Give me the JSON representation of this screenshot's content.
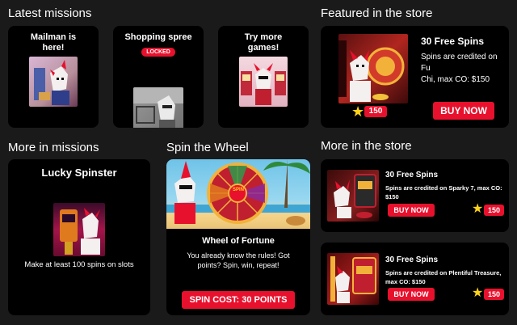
{
  "sections": {
    "latest_missions": "Latest missions",
    "featured_store": "Featured in the store",
    "more_missions": "More in missions",
    "spin_wheel": "Spin the Wheel",
    "more_store": "More in the store"
  },
  "latest_missions": [
    {
      "title_line1": "Mailman is",
      "title_line2": "here!"
    },
    {
      "title_line1": "Shopping spree",
      "title_line2": "",
      "badge": "LOCKED"
    },
    {
      "title_line1": "Try more",
      "title_line2": "games!"
    }
  ],
  "featured": {
    "title": "30 Free Spins",
    "desc_line1": "Spins are credited on Fu",
    "desc_line2": "Chi, max CO: $150",
    "price": "150",
    "button": "BUY NOW"
  },
  "more_missions": {
    "title": "Lucky Spinster",
    "desc": "Make at least 100 spins on slots"
  },
  "wheel": {
    "title": "Wheel of Fortune",
    "desc_line1": "You already know the rules! Got",
    "desc_line2": "points? Spin, win, repeat!",
    "button": "SPIN COST: 30 POINTS",
    "wheel_label": "SPIN"
  },
  "store_items": [
    {
      "title": "30 Free Spins",
      "desc_line1": "Spins are credited on Sparky 7, max CO:",
      "desc_line2": "$150",
      "button": "BUY NOW",
      "price": "150"
    },
    {
      "title": "30 Free Spins",
      "desc_line1": "Spins are credited on Plentiful Treasure,",
      "desc_line2": "max CO: $150",
      "button": "BUY NOW",
      "price": "150"
    }
  ],
  "colors": {
    "background": "#1a1a1a",
    "card": "#000000",
    "accent_red": "#e8112d",
    "star_yellow": "#ffd21a"
  },
  "icons": {
    "star": "star-icon",
    "lock": "locked-badge"
  }
}
